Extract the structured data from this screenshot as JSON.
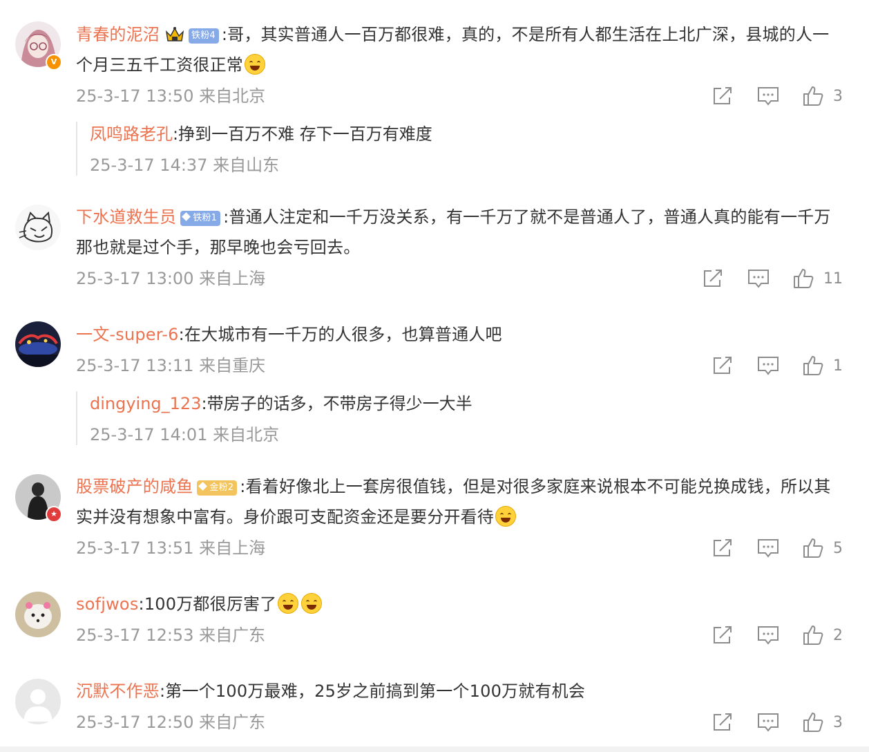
{
  "comments": [
    {
      "username": "青春的泥沼",
      "fan_badge": "铁粉4",
      "text": ":哥，其实普通人一百万都很难，真的，不是所有人都生活在上北广深，县城的人一个月三五千工资很正常",
      "time": "25-3-17 13:50 来自北京",
      "likes": "3",
      "reply": {
        "username": "凤鸣路老孔",
        "text": ":挣到一百万不难 存下一百万有难度",
        "time": "25-3-17 14:37 来自山东"
      }
    },
    {
      "username": "下水道救生员",
      "fan_badge": "铁粉1",
      "text": ":普通人注定和一千万没关系，有一千万了就不是普通人了，普通人真的能有一千万那也就是过个手，那早晚也会亏回去。",
      "time": "25-3-17 13:00 来自上海",
      "likes": "11"
    },
    {
      "username": "一文-super-6",
      "text": ":在大城市有一千万的人很多，也算普通人吧",
      "time": "25-3-17 13:11 来自重庆",
      "likes": "1",
      "reply": {
        "username": "dingying_123",
        "text": ":带房子的话多，不带房子得少一大半",
        "time": "25-3-17 14:01 来自北京"
      }
    },
    {
      "username": "股票破产的咸鱼",
      "fan_badge": "金粉2",
      "text": ":看着好像北上一套房很值钱，但是对很多家庭来说根本不可能兑换成钱，所以其实并没有想象中富有。身价跟可支配资金还是要分开看待",
      "time": "25-3-17 13:51 来自上海",
      "likes": "5"
    },
    {
      "username": "sofjwos",
      "text": ":100万都很厉害了",
      "time": "25-3-17 12:53 来自广东",
      "likes": "2"
    },
    {
      "username": "沉默不作恶",
      "text": ":第一个100万最难，25岁之前搞到第一个100万就有机会",
      "time": "25-3-17 12:50 来自广东",
      "likes": "3"
    }
  ],
  "avatar_badges": {
    "verified": "V"
  },
  "icons": [
    "share-icon",
    "comment-icon",
    "like-icon",
    "crown-icon",
    "laugh-cry-emoji"
  ],
  "colors": {
    "username": "#eb7350",
    "meta": "#999999",
    "text": "#333333",
    "fan_blue": "#86a9e8",
    "fan_gold": "#f3c45d"
  }
}
